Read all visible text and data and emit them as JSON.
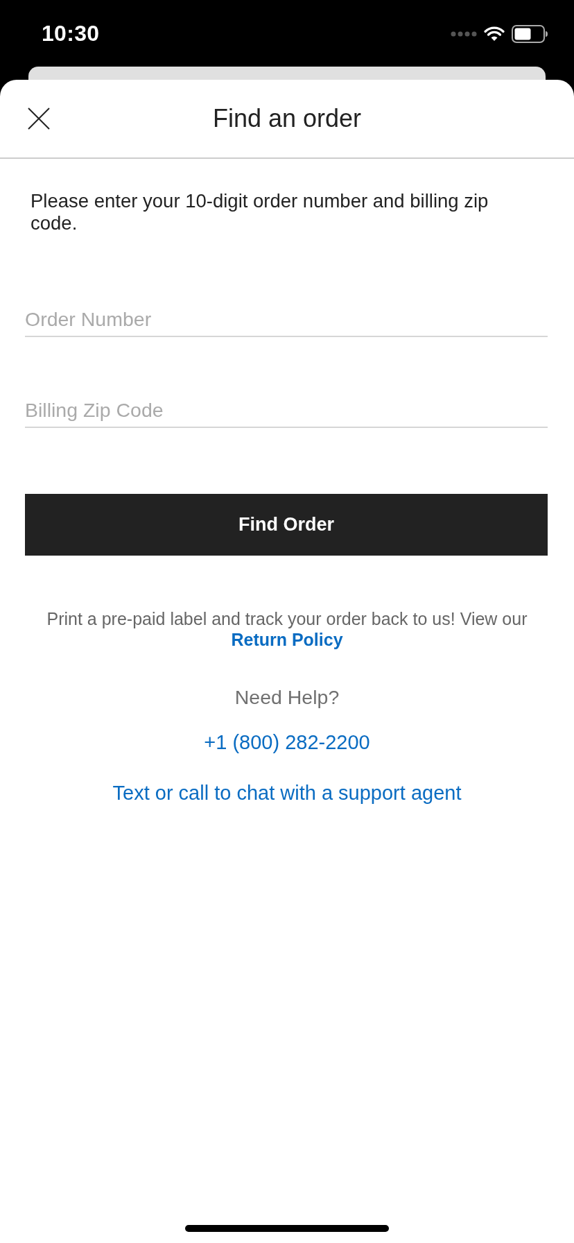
{
  "status_bar": {
    "time": "10:30"
  },
  "header": {
    "title": "Find an order"
  },
  "instructions": "Please enter your 10-digit order number and billing zip code.",
  "fields": [
    {
      "placeholder": "Order Number"
    },
    {
      "placeholder": "Billing Zip Code"
    }
  ],
  "submit_button": "Find Order",
  "return_info": {
    "text": "Print a pre-paid label and track your order back to us! View our",
    "link": "Return Policy"
  },
  "help": {
    "heading": "Need Help?",
    "phone": "+1 (800) 282-2200",
    "chat_link": "Text or call to chat with a support agent"
  }
}
